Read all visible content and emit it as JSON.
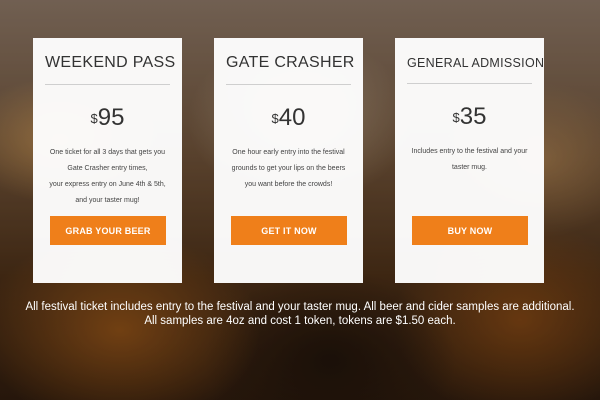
{
  "cards": [
    {
      "title": "WEEKEND PASS",
      "currency": "$",
      "amount": "95",
      "description_lines": [
        "One ticket for all 3 days that gets you",
        "Gate Crasher entry times,",
        "your express entry on June 4th & 5th,",
        "and your taster mug!"
      ],
      "button_label": "GRAB YOUR BEER"
    },
    {
      "title": "GATE CRASHER",
      "currency": "$",
      "amount": "40",
      "description_lines": [
        "One hour early entry into the festival",
        "grounds to get your lips on the beers",
        "you want before the crowds!"
      ],
      "button_label": "GET IT NOW"
    },
    {
      "title": "GENERAL ADMISSION",
      "currency": "$",
      "amount": "35",
      "description_lines": [
        "Includes entry to the festival and your",
        "taster mug."
      ],
      "button_label": "BUY NOW"
    }
  ],
  "footer_note": "All festival ticket includes entry to the festival and your taster mug. All beer and cider samples are additional. All samples are 4oz and cost 1 token, tokens are $1.50 each.",
  "colors": {
    "button": "#ef7f1a",
    "card_background": "#ffffff",
    "text": "#333333"
  }
}
